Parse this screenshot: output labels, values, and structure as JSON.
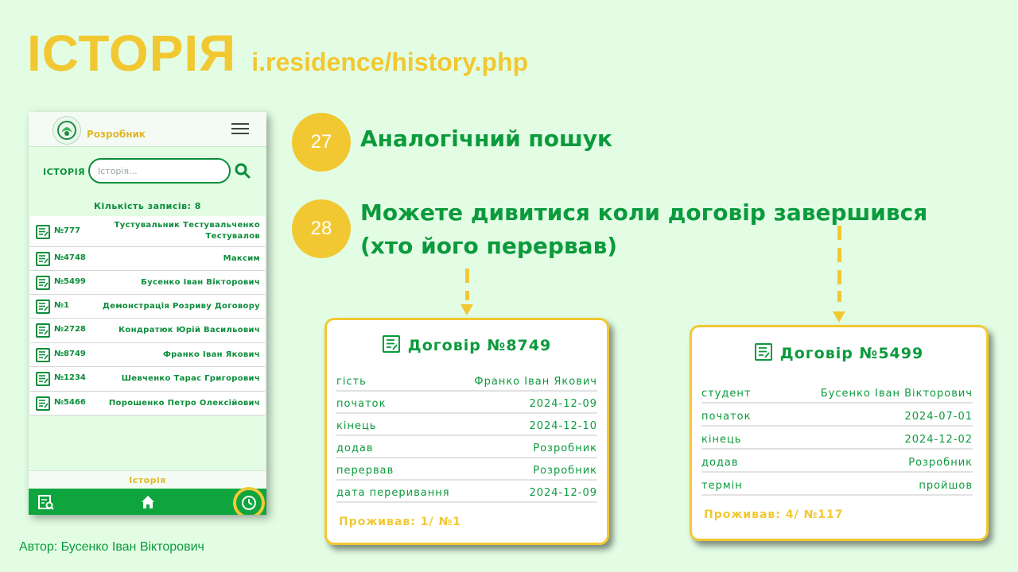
{
  "slide": {
    "title": "ІСТОРІЯ",
    "url": "i.residence/history.php",
    "author": "Автор: Бусенко Іван Вікторович"
  },
  "phone": {
    "brand": "Розробник",
    "history_label": "ІСТОРІЯ",
    "search_placeholder": "Історія...",
    "count_text": "Кількість записів: 8",
    "records": [
      {
        "no": "№777",
        "name": "Тустувальник Тестувальченко Тестувалов"
      },
      {
        "no": "№4748",
        "name": "Максим"
      },
      {
        "no": "№5499",
        "name": "Бусенко Іван Вікторович"
      },
      {
        "no": "№1",
        "name": "Демонстрація Розриву Договору"
      },
      {
        "no": "№2728",
        "name": "Кондратюк Юрій Васильович"
      },
      {
        "no": "№8749",
        "name": "Франко Іван Якович"
      },
      {
        "no": "№1234",
        "name": "Шевченко Тарас Григорович"
      },
      {
        "no": "№5466",
        "name": "Порошенко Петро Олексійович"
      }
    ],
    "footer_label": "Історія",
    "nav_icons": [
      "search-list-icon",
      "home-icon",
      "history-clock-icon"
    ]
  },
  "bullets": [
    {
      "num": "27",
      "text": "Аналогічний пошук"
    },
    {
      "num": "28",
      "text_line1": "Можете дивитися коли договір завершився",
      "text_line2": "(хто його перервав)"
    }
  ],
  "card1": {
    "title": "Договір №8749",
    "rows": [
      {
        "k": "гість",
        "v": "Франко Іван Якович"
      },
      {
        "k": "початок",
        "v": "2024-12-09"
      },
      {
        "k": "кінець",
        "v": "2024-12-10"
      },
      {
        "k": "додав",
        "v": "Розробник"
      },
      {
        "k": "перервав",
        "v": "Розробник"
      },
      {
        "k": "дата переривання",
        "v": "2024-12-09"
      }
    ],
    "footer": "Проживав: 1/ №1"
  },
  "card2": {
    "title": "Договір №5499",
    "rows": [
      {
        "k": "студент",
        "v": "Бусенко Іван Вікторович"
      },
      {
        "k": "початок",
        "v": "2024-07-01"
      },
      {
        "k": "кінець",
        "v": "2024-12-02"
      },
      {
        "k": "додав",
        "v": "Розробник"
      },
      {
        "k": "термін",
        "v": "пройшов"
      }
    ],
    "footer": "Проживав: 4/ №117"
  },
  "colors": {
    "accent_yellow": "#f2c832",
    "brand_green": "#0b9a3c",
    "nav_green": "#0ea53f",
    "background": "#e2fde4"
  }
}
